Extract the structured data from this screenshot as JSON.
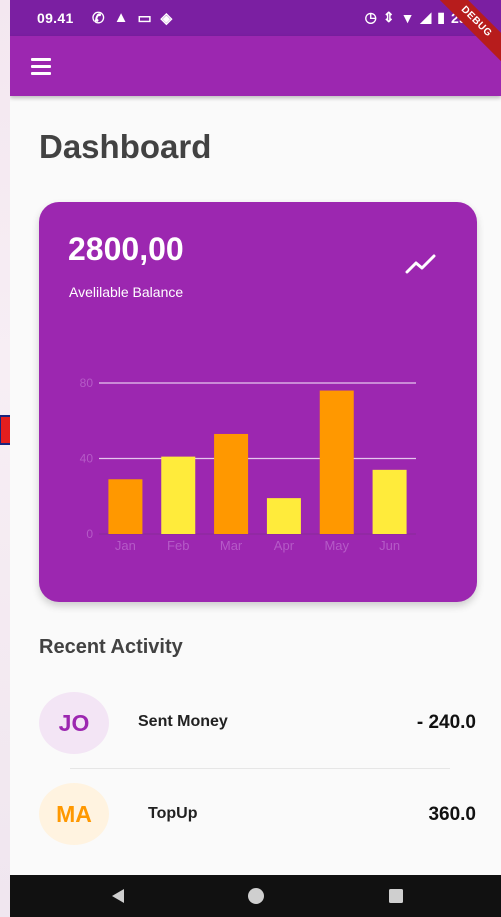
{
  "status_bar": {
    "time": "09.41",
    "battery": "29%"
  },
  "app_bar": {
    "menu_icon": "menu-icon",
    "debug_banner": "DEBUG"
  },
  "page": {
    "title": "Dashboard"
  },
  "balance_card": {
    "amount": "2800,00",
    "label": "Avelilable Balance",
    "icon": "trending-up-icon",
    "background": "#9c27b0"
  },
  "chart_data": {
    "type": "bar",
    "categories": [
      "Jan",
      "Feb",
      "Mar",
      "Apr",
      "May",
      "Jun"
    ],
    "values": [
      29,
      41,
      53,
      19,
      76,
      34
    ],
    "colors": [
      "#ff9800",
      "#ffeb3b",
      "#ff9800",
      "#ffeb3b",
      "#ff9800",
      "#ffeb3b"
    ],
    "yticks": [
      "0",
      "40",
      "80"
    ],
    "ylim": [
      0,
      80
    ],
    "grid": true
  },
  "recent_activity": {
    "heading": "Recent Activity",
    "items": [
      {
        "initials": "JO",
        "label": "Sent Money",
        "amount": "- 240.0",
        "avatar_bg": "#f3e5f5",
        "avatar_fg": "#9c27b0"
      },
      {
        "initials": "MA",
        "label": "TopUp",
        "amount": "360.0",
        "avatar_bg": "#fff3e0",
        "avatar_fg": "#ff9800"
      }
    ]
  },
  "nav_bar": {
    "icons": [
      "back-icon",
      "home-icon",
      "recents-icon"
    ]
  }
}
